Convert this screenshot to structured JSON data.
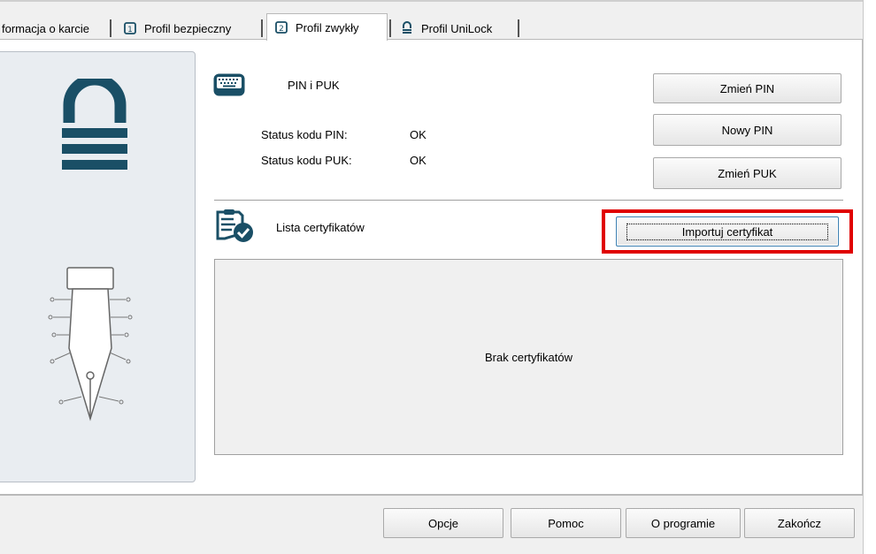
{
  "tabs": [
    {
      "label": "formacja o karcie",
      "icon": "none"
    },
    {
      "label": "Profil bezpieczny",
      "icon": "card-icon"
    },
    {
      "label": "Profil zwykły",
      "icon": "card-icon"
    },
    {
      "label": "Profil UniLock",
      "icon": "lock-icon"
    }
  ],
  "pin_section": {
    "title": "PIN i PUK",
    "pin_status_label": "Status kodu PIN:",
    "pin_status_value": "OK",
    "puk_status_label": "Status kodu PUK:",
    "puk_status_value": "OK"
  },
  "buttons": {
    "change_pin": "Zmień PIN",
    "new_pin": "Nowy PIN",
    "change_puk": "Zmień PUK",
    "import_cert": "Importuj certyfikat"
  },
  "cert_section": {
    "title": "Lista certyfikatów",
    "empty_text": "Brak certyfikatów"
  },
  "footer": {
    "options": "Opcje",
    "help": "Pomoc",
    "about": "O programie",
    "close": "Zakończ"
  },
  "icons": [
    "keyboard-icon",
    "certificate-list-icon",
    "padlock-icon",
    "pen-nib-icon"
  ],
  "colors": {
    "accent": "#1a4f66",
    "highlight": "#e00000"
  }
}
